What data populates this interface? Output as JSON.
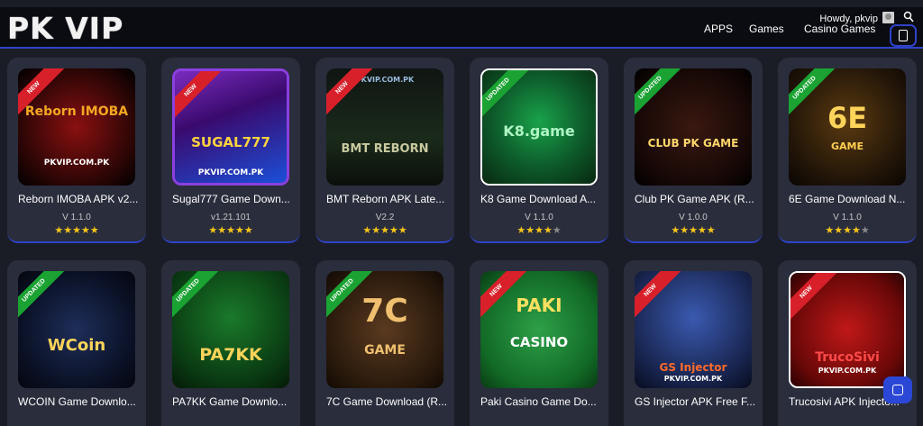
{
  "header": {
    "logo": "PK VIP",
    "nav": [
      "APPS",
      "Games",
      "Casino Games"
    ],
    "greeting": "Howdy, pkvip"
  },
  "cards": [
    {
      "title": "Reborn IMOBA APK v2...",
      "version": "V 1.1.0",
      "ribbon": "NEW",
      "art": "Reborn IMOBA",
      "art2": "PKVIP.COM.PK",
      "rating": 4.5
    },
    {
      "title": "Sugal777 Game Down...",
      "version": "v1.21.101",
      "ribbon": "NEW",
      "art": "SUGAL777",
      "art2": "PKVIP.COM.PK",
      "rating": 4.5
    },
    {
      "title": "BMT Reborn APK Late...",
      "version": "V2.2",
      "ribbon": "NEW",
      "art": "BMT REBORN",
      "art2": "PKVIP.COM.PK",
      "rating": 4.5
    },
    {
      "title": "K8 Game Download A...",
      "version": "V 1.1.0",
      "ribbon": "UPDATED",
      "art": "K8.game",
      "art2": "",
      "rating": 4
    },
    {
      "title": "Club PK Game APK (R...",
      "version": "V 1.0.0",
      "ribbon": "UPDATED",
      "art": "CLUB PK GAME",
      "art2": "",
      "rating": 4.5
    },
    {
      "title": "6E Game Download N...",
      "version": "V 1.1.0",
      "ribbon": "UPDATED",
      "art": "6E",
      "art2": "GAME",
      "rating": 4
    },
    {
      "title": "WCOIN Game Downlo...",
      "version": "",
      "ribbon": "UPDATED",
      "art": "WCoin",
      "art2": "",
      "rating": 0
    },
    {
      "title": "PA7KK Game Downlo...",
      "version": "",
      "ribbon": "UPDATED",
      "art": "PA7KK",
      "art2": "",
      "rating": 0
    },
    {
      "title": "7C Game Download (R...",
      "version": "",
      "ribbon": "UPDATED",
      "art": "7C",
      "art2": "GAME",
      "rating": 0
    },
    {
      "title": "Paki Casino Game Do...",
      "version": "",
      "ribbon": "NEW",
      "art": "PAKI",
      "art2": "CASINO",
      "rating": 0
    },
    {
      "title": "GS Injector APK Free F...",
      "version": "",
      "ribbon": "NEW",
      "art": "GS Injector",
      "art2": "PKVIP.COM.PK",
      "rating": 0
    },
    {
      "title": "Trucosivi APK Injecto...",
      "version": "",
      "ribbon": "NEW",
      "art": "TrucoSivi",
      "art2": "PKVIP.COM.PK",
      "rating": 0
    }
  ],
  "colors": {
    "accent": "#2f43c9",
    "card_bg": "#2a2d3c",
    "page_bg": "#1b1d26",
    "header_bg": "#0b0c11",
    "new_ribbon": "#d8202a",
    "updated_ribbon": "#1aa332",
    "star": "#f5c518"
  }
}
